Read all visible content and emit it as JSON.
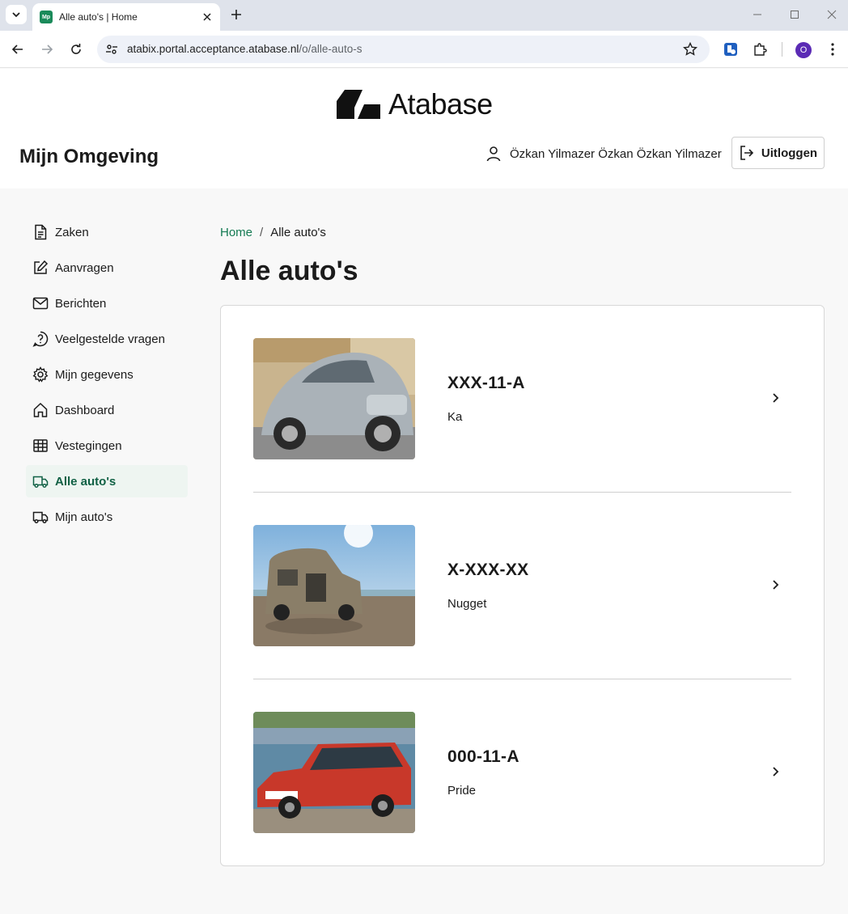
{
  "browser": {
    "tab_title": "Alle auto's | Home",
    "favicon_text": "Mp",
    "url_host": "atabix.portal.acceptance.atabase.nl",
    "url_path": "/o/alle-auto-s",
    "profile_initial": "O"
  },
  "header": {
    "logo_text": "Atabase",
    "site_title": "Mijn Omgeving",
    "user_name": "Özkan Yilmazer Özkan Özkan Yilmazer",
    "logout_label": "Uitloggen"
  },
  "sidebar": {
    "items": [
      {
        "label": "Zaken",
        "icon": "document-icon"
      },
      {
        "label": "Aanvragen",
        "icon": "edit-icon"
      },
      {
        "label": "Berichten",
        "icon": "mail-icon"
      },
      {
        "label": "Veelgestelde vragen",
        "icon": "help-icon"
      },
      {
        "label": "Mijn gegevens",
        "icon": "gear-icon"
      },
      {
        "label": "Dashboard",
        "icon": "home-icon"
      },
      {
        "label": "Vestegingen",
        "icon": "table-icon"
      },
      {
        "label": "Alle auto's",
        "icon": "truck-icon",
        "active": true
      },
      {
        "label": "Mijn auto's",
        "icon": "truck-icon"
      }
    ]
  },
  "breadcrumb": {
    "home": "Home",
    "separator": "/",
    "current": "Alle auto's"
  },
  "page_title": "Alle auto's",
  "cars": [
    {
      "plate": "XXX-11-A",
      "model": "Ka",
      "color": "#aab2b8"
    },
    {
      "plate": "X-XXX-XX",
      "model": "Nugget",
      "color": "#8a7e68"
    },
    {
      "plate": "000-11-A",
      "model": "Pride",
      "color": "#c8382a"
    }
  ],
  "colors": {
    "accent": "#137a52",
    "active_nav": "#116145"
  }
}
